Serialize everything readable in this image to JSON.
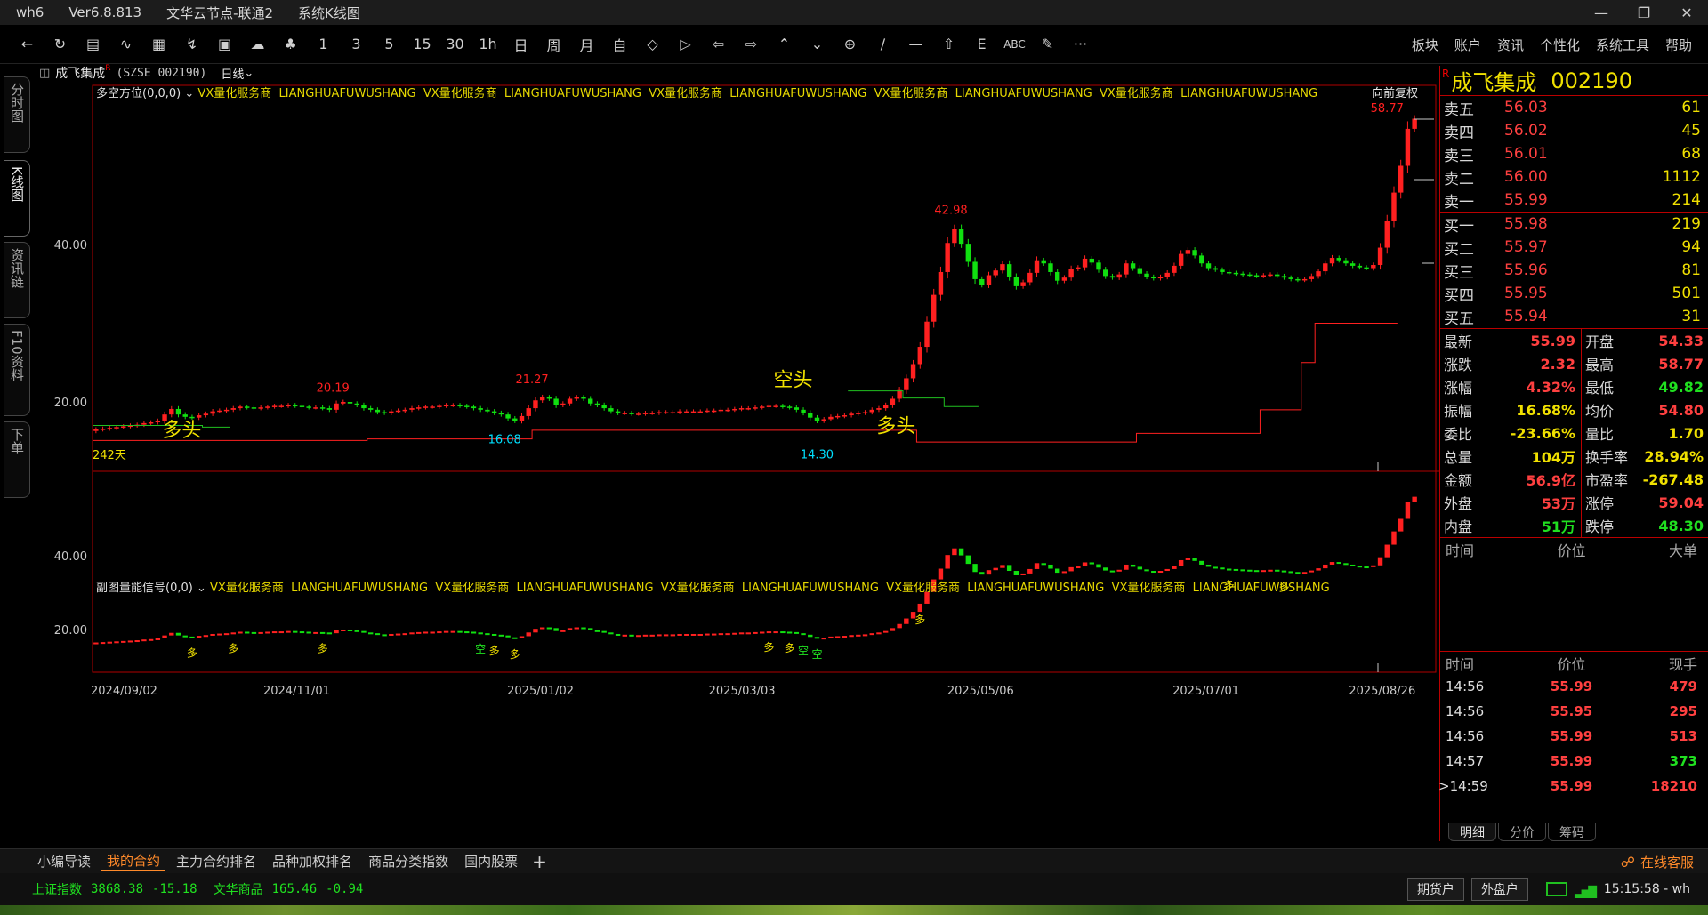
{
  "titlebar": {
    "app": "wh6",
    "version": "Ver6.8.813",
    "server": "文华云节点-联通2",
    "view": "系统K线图"
  },
  "toolbar": {
    "icons": [
      "back-icon",
      "refresh-icon",
      "list-icon",
      "line-chart-icon",
      "bar-chart-icon",
      "lightning-icon",
      "screenshot-icon",
      "cloud-icon",
      "bell-icon"
    ],
    "periods": [
      "1",
      "3",
      "5",
      "15",
      "30",
      "1h",
      "日",
      "周",
      "月",
      "自"
    ],
    "tools": [
      "zoom-out-icon",
      "fit-icon",
      "arrow-left-icon",
      "arrow-right-icon",
      "zoom-in-icon",
      "zoom-in2-icon",
      "crosshair-icon",
      "draw-line-icon",
      "hline-icon",
      "home-icon",
      "e-icon",
      "abc-icon",
      "pen-icon",
      "more-icon"
    ],
    "text_icons": {
      "e": "E",
      "abc": "ABC",
      "more": "···"
    }
  },
  "menu": [
    "板块",
    "账户",
    "资讯",
    "个性化",
    "系统工具",
    "帮助"
  ],
  "side_tabs": [
    "分时图",
    "K线图",
    "资讯链",
    "F10资料",
    "下单"
  ],
  "chart_header": {
    "name": "成飞集成",
    "mark": "R",
    "code": "(SZSE 002190)",
    "period": "日线"
  },
  "main_indicator": {
    "name": "多空方位(0,0,0)",
    "ads": [
      "VX量化服务商",
      "LIANGHUAFUWUSHANG",
      "VX量化服务商",
      "LIANGHUAFUWUSHANG",
      "VX量化服务商",
      "LIANGHUAFUWUSHANG",
      "VX量化服务商",
      "LIANGHUAFUWUSHANG",
      "VX量化服务商",
      "LIANGHUAFUWUSHANG"
    ],
    "right_label": "向前复权"
  },
  "sub_indicator": {
    "name": "副图量能信号(0,0)",
    "ads": [
      "VX量化服务商",
      "LIANGHUAFUWUSHANG",
      "VX量化服务商",
      "LIANGHUAFUWUSHANG",
      "VX量化服务商",
      "LIANGHUAFUWUSHANG",
      "VX量化服务商",
      "LIANGHUAFUWUSHANG",
      "VX量化服务商",
      "LIANGHUAFUWUSHANG"
    ]
  },
  "chart_data": {
    "type": "candlestick",
    "main_y_ticks": [
      "40.00",
      "20.00"
    ],
    "sub_y_ticks": [
      "40.00",
      "20.00"
    ],
    "x_dates": [
      "2024/09/02",
      "2024/11/01",
      "2025/01/02",
      "2025/03/03",
      "2025/05/06",
      "2025/07/01",
      "2025/08/26"
    ],
    "annotations": {
      "high_1": "20.19",
      "high_2": "21.27",
      "high_3": "42.98",
      "high_4": "58.77",
      "low_1": "16.08",
      "low_2": "14.30",
      "bull_1": "多头",
      "bull_2": "多头",
      "bear_1": "空头",
      "days": "242天"
    },
    "signal_marks": [
      "多",
      "多",
      "多",
      "空",
      "多",
      "多",
      "多",
      "多",
      "空",
      "空",
      "多",
      "多",
      "多"
    ],
    "series": [
      {
        "name": "close",
        "values": [
          16.5,
          16.6,
          16.7,
          16.8,
          16.9,
          17.0,
          17.1,
          17.3,
          17.4,
          17.6,
          18.4,
          19.1,
          18.4,
          18.1,
          18.0,
          18.3,
          18.5,
          18.8,
          18.9,
          19.0,
          19.2,
          19.4,
          19.3,
          19.2,
          19.3,
          19.4,
          19.5,
          19.5,
          19.6,
          19.5,
          19.4,
          19.3,
          19.3,
          19.2,
          19.0,
          19.8,
          20.0,
          19.8,
          19.6,
          19.2,
          19.0,
          18.7,
          18.6,
          18.8,
          18.9,
          19.0,
          19.2,
          19.3,
          19.4,
          19.4,
          19.5,
          19.6,
          19.6,
          19.5,
          19.4,
          19.2,
          19.0,
          18.8,
          18.6,
          18.4,
          17.9,
          17.6,
          18.2,
          19.2,
          20.2,
          20.6,
          20.4,
          19.6,
          19.8,
          20.4,
          20.6,
          20.4,
          19.8,
          19.6,
          19.2,
          18.8,
          18.6,
          18.6,
          18.5,
          18.5,
          18.6,
          18.6,
          18.7,
          18.7,
          18.7,
          18.8,
          18.8,
          18.8,
          18.8,
          18.9,
          18.9,
          19.0,
          19.0,
          19.1,
          19.2,
          19.2,
          19.3,
          19.4,
          19.5,
          19.5,
          19.4,
          19.3,
          19.0,
          18.6,
          18.0,
          17.6,
          17.8,
          18.1,
          18.2,
          18.3,
          18.5,
          18.6,
          18.7,
          19.0,
          19.2,
          19.6,
          20.4,
          21.5,
          23.0,
          24.8,
          27.0,
          30.2,
          33.6,
          36.5,
          40.2,
          42.0,
          40.1,
          37.8,
          35.6,
          34.9,
          36.1,
          36.7,
          37.5,
          35.9,
          34.7,
          35.2,
          36.4,
          38.0,
          37.6,
          36.5,
          35.4,
          35.8,
          36.9,
          37.1,
          38.2,
          37.7,
          36.8,
          36.0,
          35.8,
          36.2,
          37.6,
          37.0,
          36.3,
          35.9,
          35.7,
          35.9,
          36.4,
          37.3,
          38.8,
          39.3,
          38.6,
          37.6,
          37.0,
          36.8,
          36.5,
          36.4,
          36.3,
          36.2,
          36.1,
          36.0,
          36.1,
          36.2,
          36.0,
          35.8,
          35.6,
          35.5,
          35.6,
          36.0,
          36.6,
          37.6,
          38.3,
          38.0,
          37.6,
          37.3,
          37.1,
          37.0,
          37.4,
          39.6,
          43.0,
          46.6,
          50.0,
          54.7,
          55.99
        ]
      }
    ]
  },
  "quote": {
    "name": "成飞集成",
    "code": "002190",
    "mark": "R",
    "sell": [
      {
        "label": "卖五",
        "price": "56.03",
        "vol": "61"
      },
      {
        "label": "卖四",
        "price": "56.02",
        "vol": "45"
      },
      {
        "label": "卖三",
        "price": "56.01",
        "vol": "68"
      },
      {
        "label": "卖二",
        "price": "56.00",
        "vol": "1112"
      },
      {
        "label": "卖一",
        "price": "55.99",
        "vol": "214"
      }
    ],
    "buy": [
      {
        "label": "买一",
        "price": "55.98",
        "vol": "219"
      },
      {
        "label": "买二",
        "price": "55.97",
        "vol": "94"
      },
      {
        "label": "买三",
        "price": "55.96",
        "vol": "81"
      },
      {
        "label": "买四",
        "price": "55.95",
        "vol": "501"
      },
      {
        "label": "买五",
        "price": "55.94",
        "vol": "31"
      }
    ],
    "stats_left": [
      {
        "label": "最新",
        "val": "55.99",
        "c": "red"
      },
      {
        "label": "涨跌",
        "val": "2.32",
        "c": "red"
      },
      {
        "label": "涨幅",
        "val": "4.32%",
        "c": "red"
      },
      {
        "label": "振幅",
        "val": "16.68%",
        "c": "yellow"
      },
      {
        "label": "委比",
        "val": "-23.66%",
        "c": "yellow"
      },
      {
        "label": "总量",
        "val": "104万",
        "c": "yellow"
      },
      {
        "label": "金额",
        "val": "56.9亿",
        "c": "red"
      },
      {
        "label": "外盘",
        "val": "53万",
        "c": "red"
      },
      {
        "label": "内盘",
        "val": "51万",
        "c": "green"
      }
    ],
    "stats_right": [
      {
        "label": "开盘",
        "val": "54.33",
        "c": "red"
      },
      {
        "label": "最高",
        "val": "58.77",
        "c": "red"
      },
      {
        "label": "最低",
        "val": "49.82",
        "c": "green"
      },
      {
        "label": "均价",
        "val": "54.80",
        "c": "red"
      },
      {
        "label": "量比",
        "val": "1.70",
        "c": "yellow"
      },
      {
        "label": "换手率",
        "val": "28.94%",
        "c": "yellow"
      },
      {
        "label": "市盈率",
        "val": "-267.48",
        "c": "yellow"
      },
      {
        "label": "涨停",
        "val": "59.04",
        "c": "red"
      },
      {
        "label": "跌停",
        "val": "48.30",
        "c": "green"
      }
    ],
    "big_head": [
      "时间",
      "价位",
      "大单"
    ],
    "tick_head": [
      "时间",
      "价位",
      "现手"
    ],
    "ticks": [
      {
        "t": "14:56",
        "p": "55.99",
        "v": "479",
        "c": "red"
      },
      {
        "t": "14:56",
        "p": "55.95",
        "v": "295",
        "c": "red"
      },
      {
        "t": "14:56",
        "p": "55.99",
        "v": "513",
        "c": "red"
      },
      {
        "t": "14:57",
        "p": "55.99",
        "v": "373",
        "c": "green"
      },
      {
        "t": "14:59",
        "p": "55.99",
        "v": "18210",
        "c": "red"
      }
    ],
    "tabs": [
      "明细",
      "分价",
      "筹码"
    ]
  },
  "bottom_tabs": [
    "小编导读",
    "我的合约",
    "主力合约排名",
    "品种加权排名",
    "商品分类指数",
    "国内股票"
  ],
  "bottom_plus": "+",
  "service": "在线客服",
  "status": {
    "idx1_name": "上证指数",
    "idx1_val": "3868.38",
    "idx1_chg": "-15.18",
    "idx2_name": "文华商品",
    "idx2_val": "165.46",
    "idx2_chg": "-0.94",
    "acct1": "期货户",
    "acct2": "外盘户",
    "clock": "15:15:58 - wh"
  },
  "colors": {
    "up": "#ff2020",
    "down": "#10e010",
    "axis": "#b00000",
    "text_yellow": "#f0e000",
    "cyan": "#00e0ff"
  }
}
